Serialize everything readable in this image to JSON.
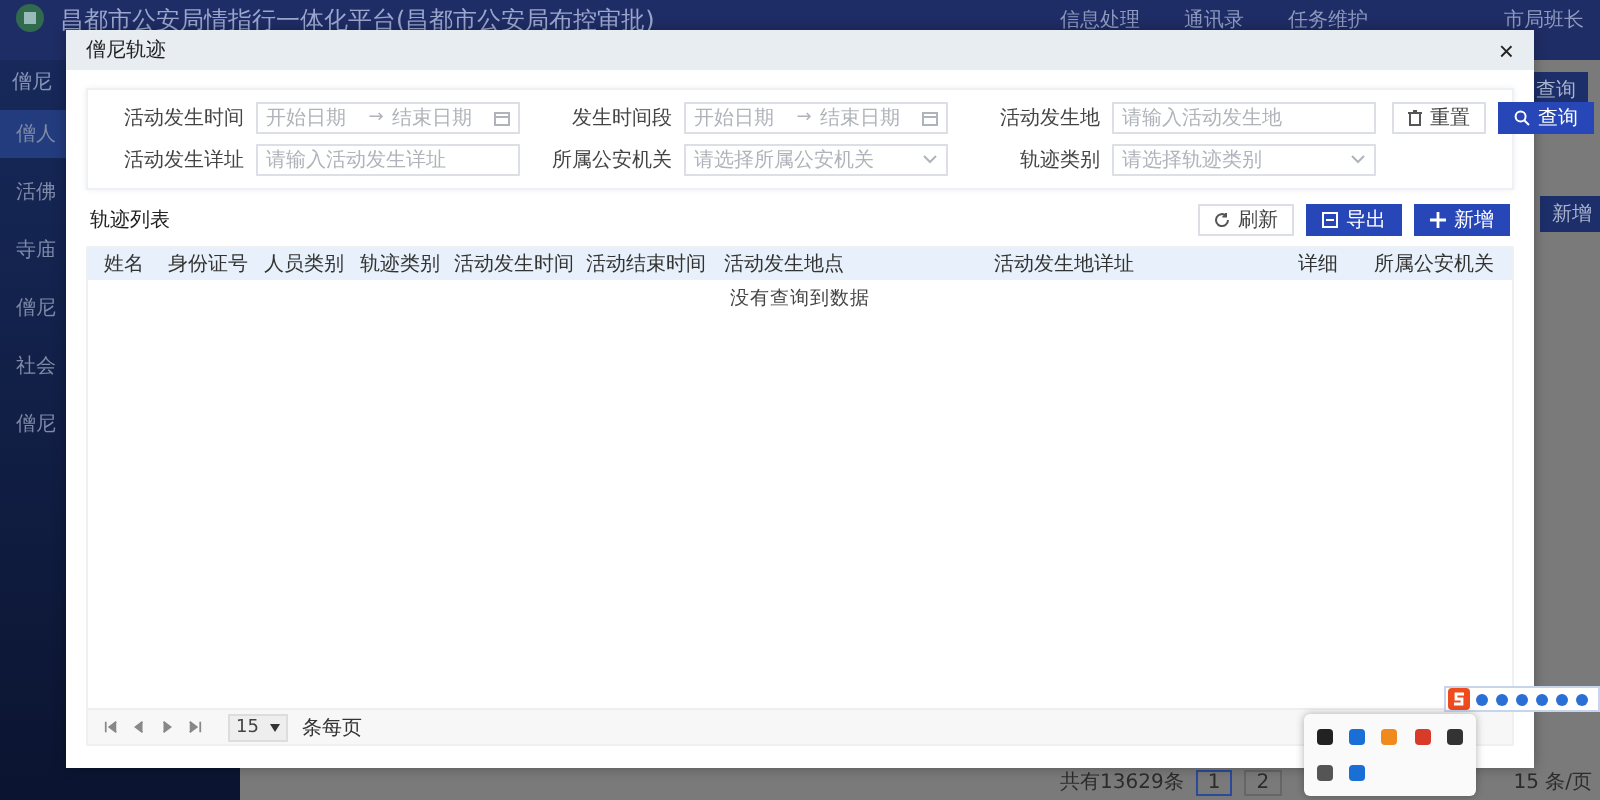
{
  "app_header": {
    "title": "昌都市公安局情指行一体化平台(昌都市公安局布控审批)",
    "nav": [
      "信息处理",
      "通讯录",
      "任务维护"
    ],
    "user": "市局班长"
  },
  "sidebar": {
    "title": "僧尼",
    "items": [
      {
        "label": "僧人",
        "selected": true
      },
      {
        "label": "活佛",
        "selected": false
      },
      {
        "label": "寺庙",
        "selected": false
      },
      {
        "label": "僧尼",
        "selected": false
      },
      {
        "label": "社会",
        "selected": false
      },
      {
        "label": "僧尼",
        "selected": false
      }
    ]
  },
  "background": {
    "search_button": "查询",
    "add_button": "新增",
    "pagination": {
      "total": "共有13629条",
      "pages": [
        {
          "label": "1",
          "selected": true
        },
        {
          "label": "2",
          "selected": false
        }
      ],
      "page_size": "15 条/页"
    }
  },
  "dialog": {
    "title": "僧尼轨迹",
    "close": "×",
    "filters": [
      {
        "kind": "date_range",
        "label": "活动发生时间",
        "start": "开始日期",
        "separator": "→",
        "end": "结束日期"
      },
      {
        "kind": "date_range",
        "label": "发生时间段",
        "start": "开始日期",
        "separator": "→",
        "end": "结束日期"
      },
      {
        "kind": "text",
        "label": "活动发生地",
        "placeholder": "请输入活动发生地"
      },
      {
        "kind": "text",
        "label": "活动发生详址",
        "placeholder": "请输入活动发生详址"
      },
      {
        "kind": "select",
        "label": "所属公安机关",
        "placeholder": "请选择所属公安机关"
      },
      {
        "kind": "select",
        "label": "轨迹类别",
        "placeholder": "请选择轨迹类别"
      }
    ],
    "reset_button": "重置",
    "search_button": "查询",
    "table_title": "轨迹列表",
    "actions": [
      {
        "kind": "refresh",
        "label": "刷新"
      },
      {
        "kind": "export",
        "label": "导出"
      },
      {
        "kind": "add",
        "label": "新增"
      }
    ],
    "columns": [
      "姓名",
      "身份证号",
      "人员类别",
      "轨迹类别",
      "活动发生时间",
      "活动结束时间",
      "活动发生地点",
      "活动发生地详址",
      "详细",
      "所属公安机关"
    ],
    "empty_text": "没有查询到数据",
    "pagination": {
      "page_size": "15",
      "suffix": "条每页"
    }
  }
}
